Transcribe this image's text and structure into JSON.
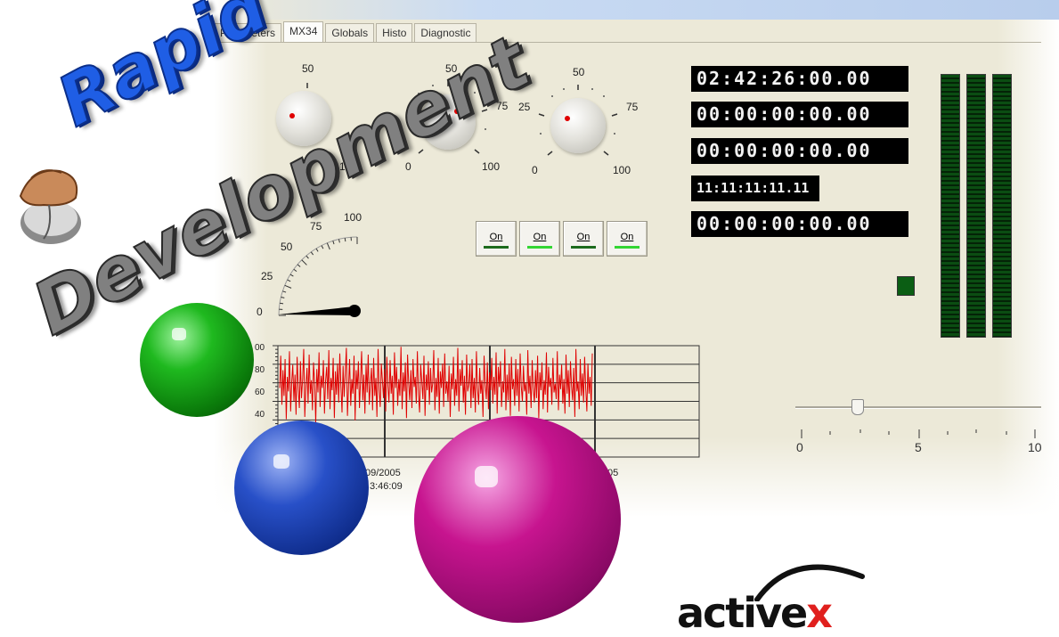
{
  "tabs": [
    "Parameters",
    "MX34",
    "Globals",
    "Histo",
    "Diagnostic"
  ],
  "knobs": [
    {
      "top_label": "50",
      "left_label": "",
      "right_label": "",
      "min_label": "",
      "max_label": "100"
    },
    {
      "top_label": "50",
      "left_label": "",
      "right_label": "75",
      "min_label": "0",
      "max_label": "100"
    },
    {
      "top_label": "50",
      "left_label": "25",
      "right_label": "75",
      "min_label": "0",
      "max_label": "100"
    }
  ],
  "timecodes": [
    "02:42:26:00.00",
    "00:00:00:00.00",
    "00:00:00:00.00",
    "11:11:11:11.11",
    "00:00:00:00.00"
  ],
  "on_buttons": [
    {
      "label": "On",
      "led_color": "#1d6b1d"
    },
    {
      "label": "On",
      "led_color": "#33d633"
    },
    {
      "label": "On",
      "led_color": "#1d6b1d"
    },
    {
      "label": "On",
      "led_color": "#33d633"
    }
  ],
  "gauge": {
    "labels": [
      "0",
      "25",
      "50",
      "75",
      "100"
    ],
    "value": 0
  },
  "slider": {
    "tick_labels": [
      "0",
      "5",
      "10"
    ],
    "value": 2.6,
    "min": 0,
    "max": 10
  },
  "status_led": {
    "color": "#0b5e14"
  },
  "branding": {
    "line1": "Rapid",
    "line2": "Development",
    "logo_main": "active",
    "logo_accent": "x"
  },
  "chart_data": {
    "type": "line",
    "y_tick_labels": [
      "00",
      "80",
      "60",
      "40"
    ],
    "x_tick_labels": [
      "09/2005",
      "3:46:09",
      "05"
    ],
    "ylim": [
      0,
      100
    ],
    "series": [
      {
        "color": "#e00000",
        "values": [
          62,
          91,
          47,
          78,
          55,
          88,
          34,
          72,
          59,
          95,
          41,
          67,
          83,
          50,
          74,
          38,
          90,
          61,
          44,
          86,
          53,
          70,
          97,
          36,
          64,
          80,
          48,
          92,
          57,
          69,
          42,
          85,
          66,
          31,
          79,
          58,
          94,
          45,
          73,
          62,
          87,
          39,
          68,
          81,
          52,
          96,
          43,
          71,
          60,
          89,
          35,
          77,
          56,
          84,
          49,
          93,
          65,
          40,
          82,
          54,
          75,
          98,
          37,
          63,
          88,
          46,
          70,
          57,
          91,
          33,
          78,
          61,
          86,
          44,
          69,
          95,
          51,
          74,
          39,
          83,
          58,
          92,
          47,
          66,
          80,
          42,
          89,
          55,
          71,
          36,
          97,
          60,
          45,
          84,
          68,
          53,
          79,
          41,
          90,
          64,
          49,
          87,
          57,
          73,
          38,
          94,
          62,
          81,
          46,
          70,
          55,
          99,
          43,
          76,
          59,
          85,
          35,
          92,
          67,
          51,
          78,
          44,
          88,
          63,
          72,
          48,
          95,
          56,
          40,
          83,
          69,
          52,
          91,
          37,
          74,
          60,
          86,
          47,
          80,
          58,
          66,
          96,
          42,
          71,
          54,
          89,
          39,
          77,
          62,
          84,
          45,
          93,
          57,
          68,
          50,
          82,
          36,
          75,
          61,
          90,
          46,
          70,
          55,
          98,
          41,
          79,
          64,
          87,
          49,
          73,
          38,
          92,
          59,
          65,
          83,
          44,
          88,
          53,
          71,
          40,
          95,
          62,
          47,
          80,
          57,
          69,
          36,
          91,
          66,
          52,
          85,
          43,
          76,
          60,
          89,
          48,
          72,
          56,
          94,
          39,
          81,
          63,
          86,
          45,
          68,
          58,
          97,
          42,
          74,
          51,
          84,
          37,
          90,
          61,
          70,
          46,
          88,
          55,
          79,
          41,
          93,
          64,
          50,
          82,
          59,
          67,
          38,
          96,
          57,
          73,
          44,
          87,
          62,
          49,
          78,
          53,
          91,
          35,
          76,
          60,
          85,
          43,
          69,
          56,
          94,
          40,
          81,
          63,
          71,
          47,
          89,
          58,
          66,
          52,
          95,
          42,
          74,
          61,
          83,
          48,
          70,
          39,
          92,
          57,
          78,
          45,
          86,
          64,
          51,
          80,
          36,
          97,
          59,
          68,
          43,
          88,
          55,
          75,
          49,
          90,
          62,
          41,
          84,
          57,
          72,
          46,
          93
        ]
      }
    ]
  }
}
